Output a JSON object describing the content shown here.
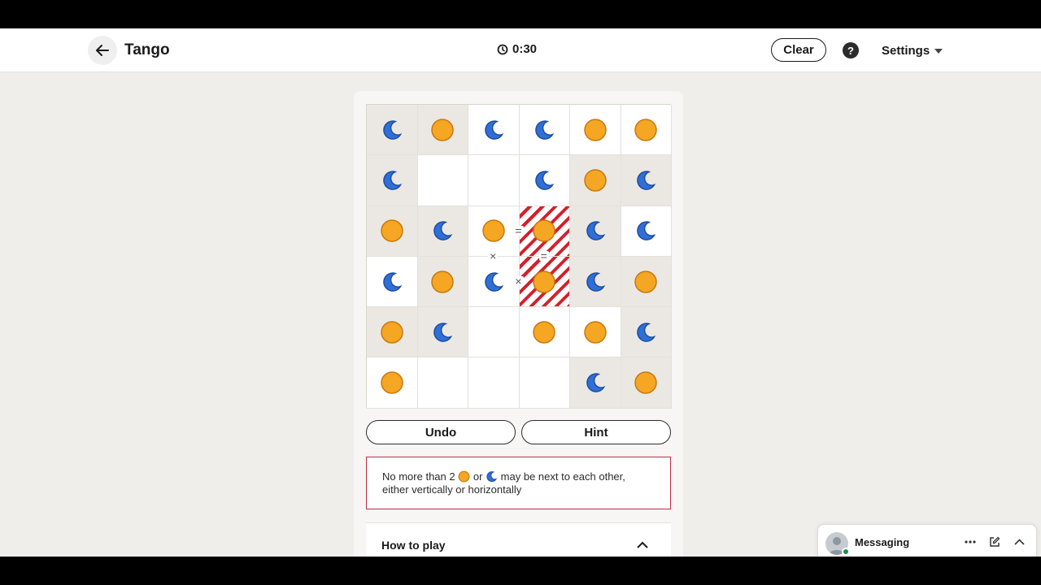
{
  "header": {
    "title": "Tango",
    "timer": "0:30",
    "clear_label": "Clear",
    "help_label": "?",
    "settings_label": "Settings"
  },
  "board": {
    "size": 6,
    "cells": [
      [
        "moon",
        "sun",
        "moon",
        "moon",
        "sun",
        "sun"
      ],
      [
        "moon",
        "",
        "",
        "moon",
        "sun",
        "moon"
      ],
      [
        "sun",
        "moon",
        "sun",
        "sun",
        "moon",
        "moon"
      ],
      [
        "moon",
        "sun",
        "moon",
        "sun",
        "moon",
        "sun"
      ],
      [
        "sun",
        "moon",
        "",
        "sun",
        "sun",
        "moon"
      ],
      [
        "sun",
        "",
        "",
        "",
        "moon",
        "sun"
      ]
    ],
    "locked": [
      [
        true,
        true,
        false,
        false,
        false,
        false
      ],
      [
        true,
        false,
        false,
        false,
        true,
        true
      ],
      [
        true,
        true,
        false,
        false,
        true,
        false
      ],
      [
        false,
        true,
        false,
        false,
        true,
        true
      ],
      [
        true,
        true,
        false,
        false,
        false,
        true
      ],
      [
        false,
        false,
        false,
        false,
        true,
        true
      ]
    ],
    "error_cells": [
      [
        2,
        3
      ],
      [
        3,
        3
      ]
    ],
    "constraints": [
      {
        "type": "=",
        "between": [
          [
            2,
            2
          ],
          [
            2,
            3
          ]
        ]
      },
      {
        "type": "×",
        "between": [
          [
            2,
            2
          ],
          [
            3,
            2
          ]
        ]
      },
      {
        "type": "=",
        "between": [
          [
            2,
            3
          ],
          [
            3,
            3
          ]
        ]
      },
      {
        "type": "×",
        "between": [
          [
            3,
            2
          ],
          [
            3,
            3
          ]
        ]
      }
    ],
    "colors": {
      "sun": "#f5a623",
      "sun_stroke": "#c8780e",
      "moon": "#2f6fd6",
      "moon_stroke": "#1e4ea3",
      "error": "#d61f2c"
    }
  },
  "controls": {
    "undo_label": "Undo",
    "hint_label": "Hint"
  },
  "error_message": {
    "part1": "No more than 2",
    "part2": "or",
    "part3": "may be next to each other,",
    "part4": "either vertically or horizontally"
  },
  "how_to_play": {
    "label": "How to play"
  },
  "messaging": {
    "label": "Messaging"
  }
}
